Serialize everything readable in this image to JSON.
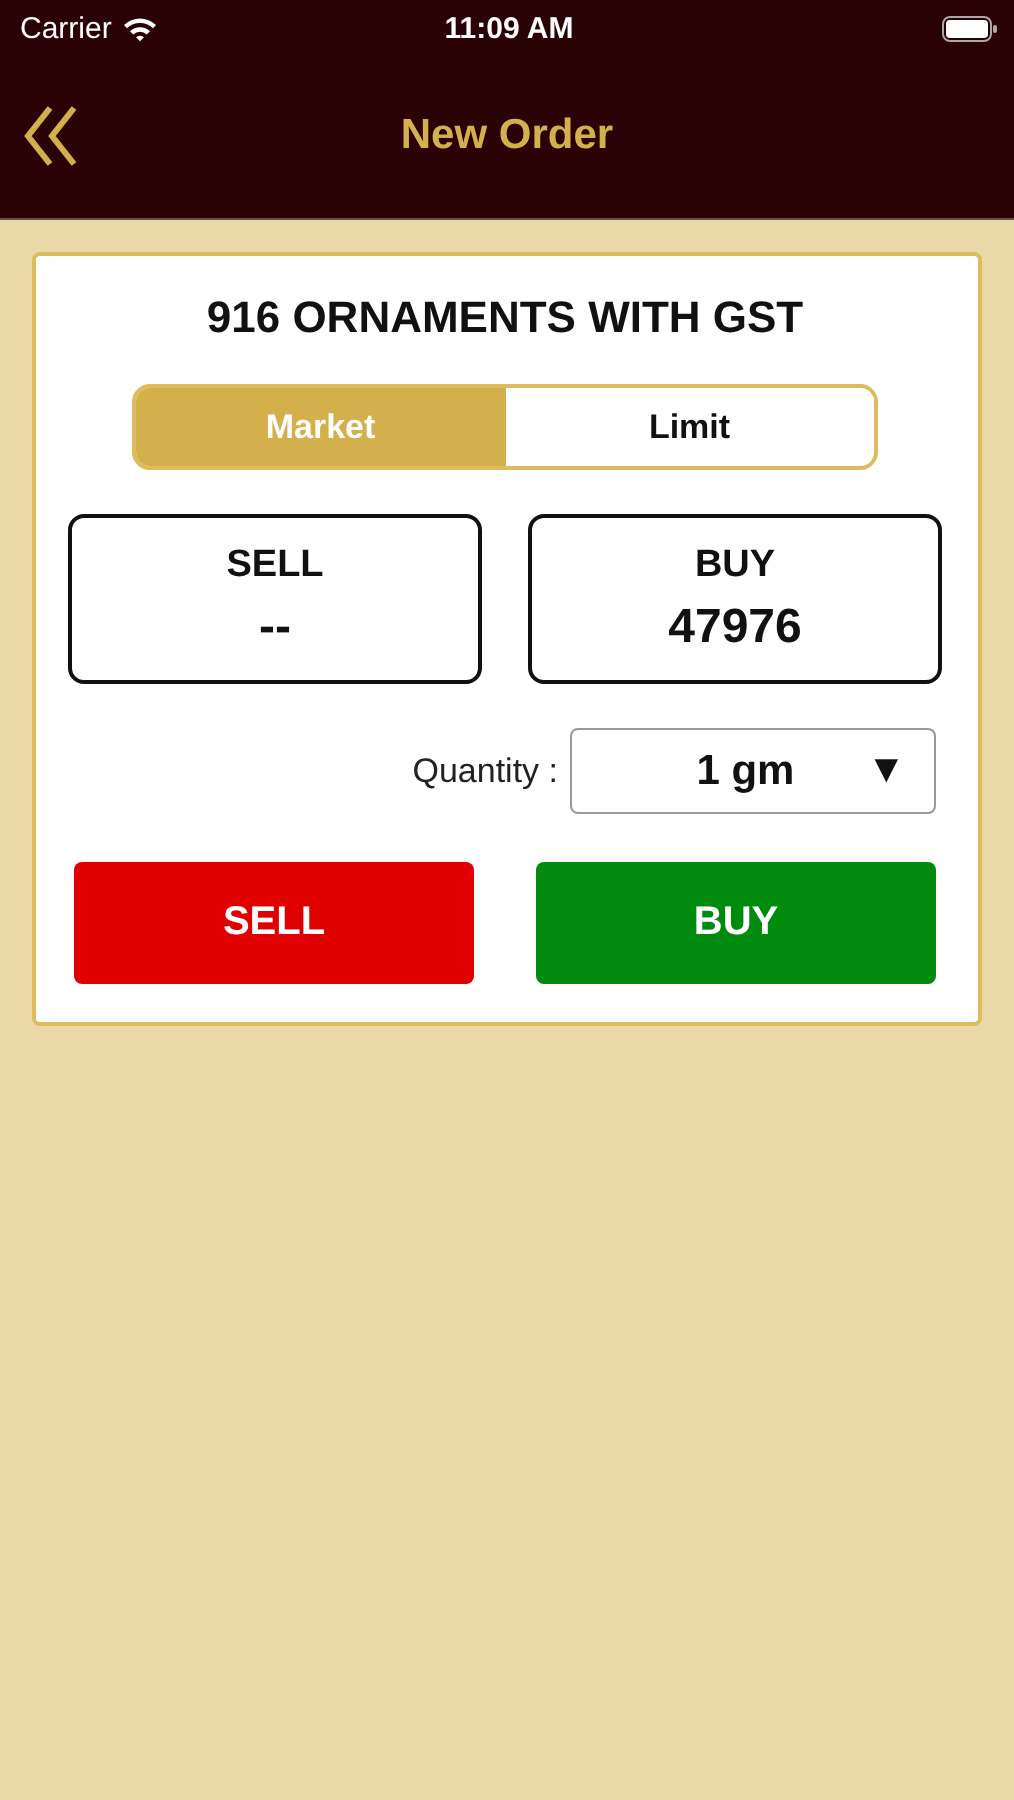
{
  "status_bar": {
    "carrier": "Carrier",
    "time": "11:09 AM"
  },
  "nav_bar": {
    "title": "New Order"
  },
  "card": {
    "title": "916 ORNAMENTS WITH GST",
    "tabs": [
      {
        "label": "Market",
        "selected": true
      },
      {
        "label": "Limit",
        "selected": false
      }
    ],
    "prices": [
      {
        "label": "SELL",
        "value": "--"
      },
      {
        "label": "BUY",
        "value": "47976"
      }
    ],
    "quantity": {
      "label": "Quantity :",
      "value": "1 gm",
      "arrow": "▼"
    },
    "actions": [
      {
        "label": "SELL",
        "kind": "sell"
      },
      {
        "label": "BUY",
        "kind": "buy"
      }
    ]
  }
}
